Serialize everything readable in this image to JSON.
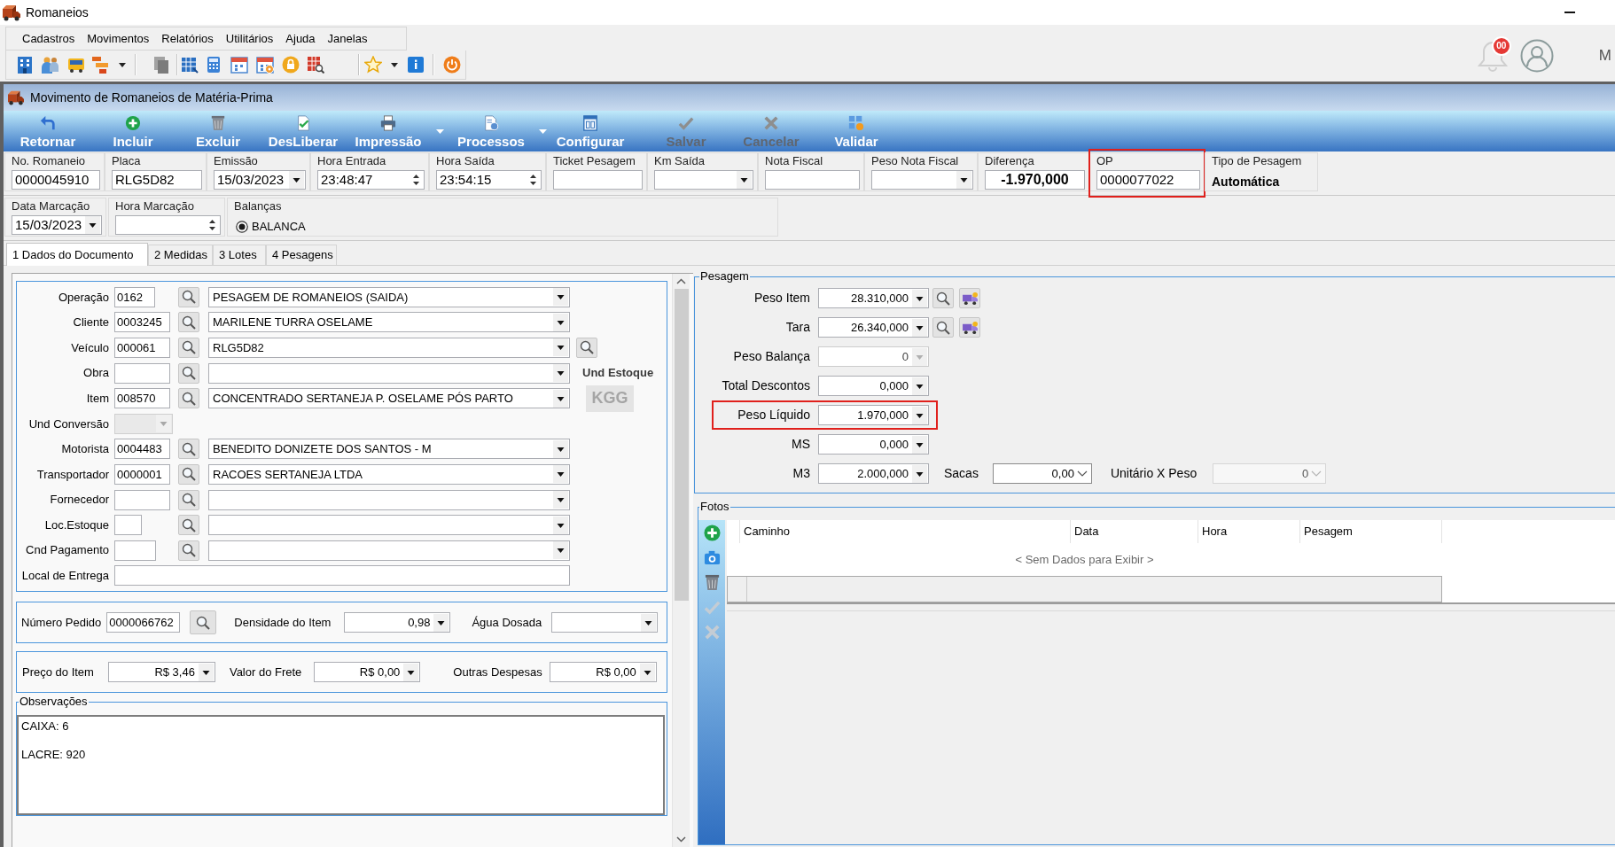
{
  "window": {
    "title": "Romaneios",
    "notifications": "00",
    "user_label": "M"
  },
  "menu": [
    {
      "label": "Cadastros"
    },
    {
      "label": "Movimentos"
    },
    {
      "label": "Relatórios"
    },
    {
      "label": "Utilitários"
    },
    {
      "label": "Ajuda"
    },
    {
      "label": "Janelas"
    }
  ],
  "form_window": {
    "title": "Movimento de Romaneios de Matéria-Prima"
  },
  "actions": [
    {
      "label": "Retornar",
      "disabled": false,
      "dropdown": false
    },
    {
      "label": "Incluir",
      "disabled": false,
      "dropdown": false
    },
    {
      "label": "Excluir",
      "disabled": false,
      "dropdown": false
    },
    {
      "label": "DesLiberar",
      "disabled": false,
      "dropdown": false
    },
    {
      "label": "Impressão",
      "disabled": false,
      "dropdown": true
    },
    {
      "label": "Processos",
      "disabled": false,
      "dropdown": true
    },
    {
      "label": "Configurar",
      "disabled": false,
      "dropdown": false
    },
    {
      "label": "Salvar",
      "disabled": true,
      "dropdown": false
    },
    {
      "label": "Cancelar",
      "disabled": true,
      "dropdown": false
    },
    {
      "label": "Validar",
      "disabled": false,
      "dropdown": false
    }
  ],
  "header": [
    {
      "label": "No. Romaneio",
      "value": "0000045910",
      "kind": "text",
      "highlighted": false
    },
    {
      "label": "Placa",
      "value": "RLG5D82",
      "kind": "text",
      "highlighted": false
    },
    {
      "label": "Emissão",
      "value": "15/03/2023",
      "kind": "date",
      "highlighted": false
    },
    {
      "label": "Hora Entrada",
      "value": "23:48:47",
      "kind": "time",
      "highlighted": false
    },
    {
      "label": "Hora Saída",
      "value": "23:54:15",
      "kind": "time",
      "highlighted": false
    },
    {
      "label": "Ticket Pesagem",
      "kind": "text",
      "highlighted": false
    },
    {
      "label": "Km Saída",
      "kind": "combo",
      "highlighted": false
    },
    {
      "label": "Nota Fiscal",
      "kind": "text",
      "highlighted": false
    },
    {
      "label": "Peso Nota Fiscal",
      "kind": "combo",
      "highlighted": false
    },
    {
      "label": "Diferença",
      "value": "-1.970,000",
      "kind": "readout",
      "highlighted": false
    },
    {
      "label": "OP",
      "value": "0000077022",
      "kind": "text",
      "highlighted": true
    },
    {
      "label": "Tipo de Pesagem",
      "value": "Automática",
      "kind": "static",
      "highlighted": false
    }
  ],
  "marking": {
    "fields": [
      {
        "label": "Data Marcação",
        "value": "15/03/2023",
        "kind": "date"
      },
      {
        "label": "Hora Marcação",
        "kind": "time"
      }
    ],
    "scales": {
      "label": "Balanças",
      "options": [
        {
          "label": "BALANCA",
          "selected": true
        }
      ]
    }
  },
  "tabs": [
    {
      "label": "1 Dados do Documento",
      "selected": true
    },
    {
      "label": "2 Medidas",
      "selected": false
    },
    {
      "label": "3 Lotes",
      "selected": false
    },
    {
      "label": "4 Pesagens",
      "selected": false
    }
  ],
  "document": {
    "lookups": [
      {
        "label": "Operação",
        "code": "0162",
        "value": "PESAGEM DE ROMANEIOS (SAIDA)",
        "kind": "lookup",
        "disabled": false,
        "extra_search": false
      },
      {
        "label": "Cliente",
        "code": "0003245",
        "value": "MARILENE TURRA OSELAME",
        "kind": "lookup",
        "disabled": false,
        "extra_search": false
      },
      {
        "label": "Veículo",
        "code": "000061",
        "value": "RLG5D82",
        "kind": "lookup",
        "disabled": false,
        "extra_search": true
      },
      {
        "label": "Obra",
        "kind": "lookup",
        "disabled": false,
        "extra_search": false
      },
      {
        "label": "Item",
        "code": "008570",
        "value": "CONCENTRADO SERTANEJA P. OSELAME PÓS PARTO",
        "kind": "lookup",
        "disabled": false,
        "extra_search": false
      },
      {
        "label": "Und Conversão",
        "kind": "select",
        "disabled": true,
        "extra_search": false
      },
      {
        "label": "Motorista",
        "code": "0004483",
        "value": "BENEDITO DONIZETE DOS SANTOS - M",
        "kind": "lookup",
        "disabled": false,
        "extra_search": false
      },
      {
        "label": "Transportador",
        "code": "0000001",
        "value": "RACOES SERTANEJA LTDA",
        "kind": "lookup",
        "disabled": false,
        "extra_search": false
      },
      {
        "label": "Fornecedor",
        "kind": "lookup",
        "disabled": false,
        "extra_search": false
      },
      {
        "label": "Loc.Estoque",
        "kind": "lookup",
        "disabled": false,
        "extra_search": false
      },
      {
        "label": "Cnd Pagamento",
        "kind": "lookup",
        "disabled": false,
        "extra_search": false
      },
      {
        "label": "Local de Entrega",
        "kind": "text",
        "disabled": false,
        "extra_search": false
      }
    ],
    "unit_stock": {
      "label": "Und Estoque",
      "value": "KGG"
    },
    "order": [
      {
        "label": "Número Pedido",
        "value": "0000066762",
        "kind": "search"
      },
      {
        "label": "Densidade do Item",
        "value": "0,98",
        "kind": "combo"
      },
      {
        "label": "Água Dosada",
        "kind": "combo"
      }
    ],
    "costs": [
      {
        "label": "Preço do Item",
        "value": "R$ 3,46"
      },
      {
        "label": "Valor do Frete",
        "value": "R$ 0,00"
      },
      {
        "label": "Outras Despesas",
        "value": "R$ 0,00"
      }
    ],
    "observations": {
      "label": "Observações",
      "value": "CAIXA: 6\n\nLACRE: 920"
    }
  },
  "pesagem": {
    "title": "Pesagem",
    "rows": [
      {
        "label": "Peso Item",
        "value": "28.310,000",
        "disabled": false,
        "highlighted": false,
        "tools": true
      },
      {
        "label": "Tara",
        "value": "26.340,000",
        "disabled": false,
        "highlighted": false,
        "tools": true
      },
      {
        "label": "Peso Balança",
        "value": "0",
        "disabled": true,
        "highlighted": false,
        "tools": false
      },
      {
        "label": "Total Descontos",
        "value": "0,000",
        "disabled": false,
        "highlighted": false,
        "tools": false
      },
      {
        "label": "Peso Líquido",
        "value": "1.970,000",
        "disabled": false,
        "highlighted": true,
        "tools": false
      },
      {
        "label": "MS",
        "value": "0,000",
        "disabled": false,
        "highlighted": false,
        "tools": false
      },
      {
        "label": "M3",
        "value": "2.000,000",
        "disabled": false,
        "highlighted": false,
        "tools": false
      }
    ],
    "extras": [
      {
        "label": "Sacas",
        "value": "0,00",
        "disabled": false
      },
      {
        "label": "Unitário X Peso",
        "value": "0",
        "disabled": true
      }
    ]
  },
  "fotos": {
    "title": "Fotos",
    "tools": [
      {
        "disabled": false
      },
      {
        "disabled": false
      },
      {
        "disabled": false
      },
      {
        "disabled": true
      },
      {
        "disabled": true
      }
    ],
    "columns": [
      "Caminho",
      "Data",
      "Hora",
      "Pesagem"
    ],
    "empty_text": "< Sem Dados para Exibir >"
  }
}
